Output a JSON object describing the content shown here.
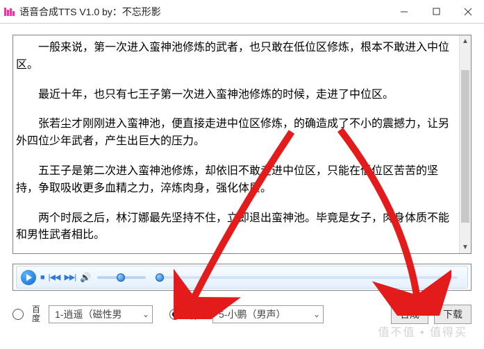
{
  "window": {
    "title": "语音合成TTS V1.0 by：不忘形影"
  },
  "paragraphs": [
    "一般来说，第一次进入蛮神池修炼的武者，也只敢在低位区修炼，根本不敢进入中位区。",
    "最近十年，也只有七王子第一次进入蛮神池修炼的时候，走进了中位区。",
    "张若尘才刚刚进入蛮神池，便直接走进中位区修炼，的确造成了不小的震撼力，让另外四位少年武者，产生出巨大的压力。",
    "五王子是第二次进入蛮神池修炼，却依旧不敢走进中位区，只能在低位区苦苦的坚持，争取吸收更多血精之力，淬炼肉身，强化体质。",
    "两个时辰之后，林汀娜最先坚持不住，立即退出蛮神池。毕竟是女子，肉身体质不能和男性武者相比。"
  ],
  "bottom": {
    "radio_baidu_label_top": "百",
    "radio_baidu_label_bot": "度",
    "voice_baidu": "1-逍遥（磁性男",
    "radio_xunfei_label": "讯飞",
    "voice_xunfei": "5-小鹏（男声）",
    "btn_synth": "合成",
    "btn_download": "下载"
  },
  "watermark": "值不值 • 值得买"
}
